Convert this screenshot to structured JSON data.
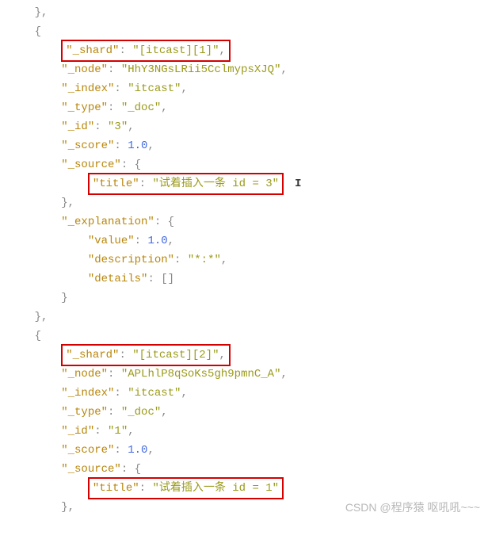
{
  "code": {
    "l0": "    },",
    "l1": "    {",
    "l2a": "        ",
    "l2_key": "\"_shard\"",
    "l2_mid": ": ",
    "l2_val": "\"[itcast][1]\"",
    "l2b": ",",
    "l3_key": "        \"_node\"",
    "l3_mid": ": ",
    "l3_val": "\"HhY3NGsLRii5CclmypsXJQ\"",
    "l3b": ",",
    "l4_key": "        \"_index\"",
    "l4_mid": ": ",
    "l4_val": "\"itcast\"",
    "l4b": ",",
    "l5_key": "        \"_type\"",
    "l5_mid": ": ",
    "l5_val": "\"_doc\"",
    "l5b": ",",
    "l6_key": "        \"_id\"",
    "l6_mid": ": ",
    "l6_val": "\"3\"",
    "l6b": ",",
    "l7_key": "        \"_score\"",
    "l7_mid": ": ",
    "l7_val": "1.0",
    "l7b": ",",
    "l8_key": "        \"_source\"",
    "l8_mid": ": ",
    "l8b": "{",
    "l9a": "            ",
    "l9_key": "\"title\"",
    "l9_mid": ": ",
    "l9_val": "\"试着插入一条 id = 3\"",
    "l9_cursor": "I",
    "l10": "        },",
    "l11_key": "        \"_explanation\"",
    "l11_mid": ": ",
    "l11b": "{",
    "l12_key": "            \"value\"",
    "l12_mid": ": ",
    "l12_val": "1.0",
    "l12b": ",",
    "l13_key": "            \"description\"",
    "l13_mid": ": ",
    "l13_val": "\"*:*\"",
    "l13b": ",",
    "l14_key": "            \"details\"",
    "l14_mid": ": ",
    "l14b": "[]",
    "l15": "        }",
    "l16": "    },",
    "l17": "    {",
    "l18a": "        ",
    "l18_key": "\"_shard\"",
    "l18_mid": ": ",
    "l18_val": "\"[itcast][2]\"",
    "l18b": ",",
    "l19_key": "        \"_node\"",
    "l19_mid": ": ",
    "l19_val": "\"APLhlP8qSoKs5gh9pmnC_A\"",
    "l19b": ",",
    "l20_key": "        \"_index\"",
    "l20_mid": ": ",
    "l20_val": "\"itcast\"",
    "l20b": ",",
    "l21_key": "        \"_type\"",
    "l21_mid": ": ",
    "l21_val": "\"_doc\"",
    "l21b": ",",
    "l22_key": "        \"_id\"",
    "l22_mid": ": ",
    "l22_val": "\"1\"",
    "l22b": ",",
    "l23_key": "        \"_score\"",
    "l23_mid": ": ",
    "l23_val": "1.0",
    "l23b": ",",
    "l24_key": "        \"_source\"",
    "l24_mid": ": ",
    "l24b": "{",
    "l25a": "            ",
    "l25_key": "\"title\"",
    "l25_mid": ": ",
    "l25_val": "\"试着插入一条 id = 1\"",
    "l26": "        },"
  },
  "watermark": "CSDN @程序猿 呕吼吼~~~"
}
